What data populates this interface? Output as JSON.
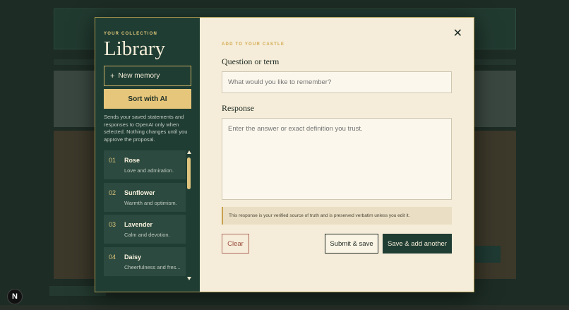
{
  "sidebar": {
    "eyebrow": "YOUR COLLECTION",
    "title": "Library",
    "new_memory_label": "New memory",
    "sort_label": "Sort with AI",
    "description": "Sends your saved statements and responses to OpenAI only when selected. Nothing changes until you approve the proposal.",
    "items": [
      {
        "num": "01",
        "name": "Rose",
        "desc": "Love and admiration."
      },
      {
        "num": "02",
        "name": "Sunflower",
        "desc": "Warmth and optimism."
      },
      {
        "num": "03",
        "name": "Lavender",
        "desc": "Calm and devotion."
      },
      {
        "num": "04",
        "name": "Daisy",
        "desc": "Cheerfulness and fres..."
      }
    ]
  },
  "main": {
    "eyebrow": "ADD TO YOUR CASTLE",
    "question_label": "Question or term",
    "question_placeholder": "What would you like to remember?",
    "response_label": "Response",
    "response_placeholder": "Enter the answer or exact definition you trust.",
    "note": "This response is your verified source of truth and is preserved verbatim unless you edit it.",
    "clear_label": "Clear",
    "submit_label": "Submit & save",
    "save_another_label": "Save & add another"
  },
  "badge": "N",
  "colors": {
    "sidebar_bg": "#1f3d33",
    "accent_gold": "#e6c67a",
    "main_bg": "#f5edd9"
  }
}
